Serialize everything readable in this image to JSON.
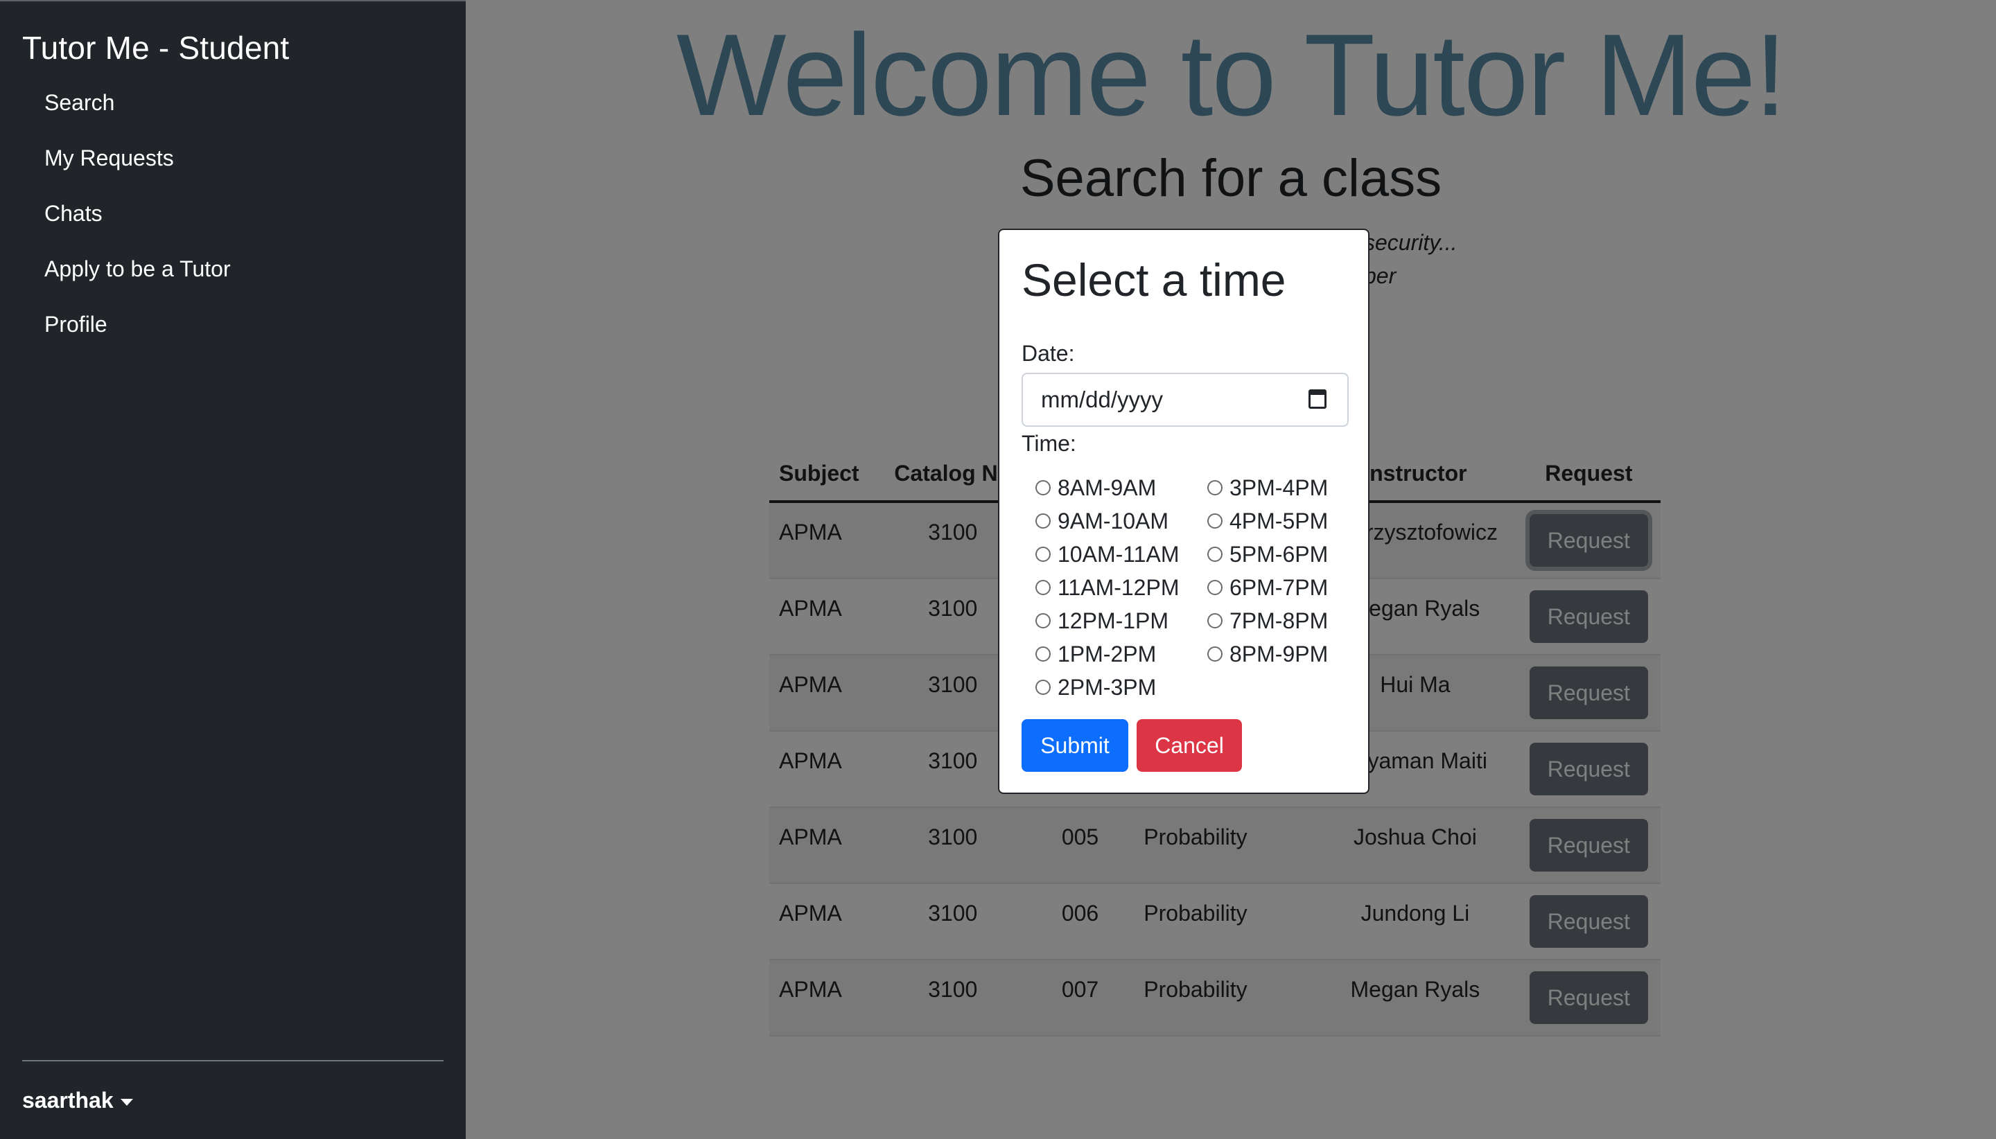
{
  "sidebar": {
    "brand": "Tutor Me - Student",
    "items": [
      {
        "label": "Search"
      },
      {
        "label": "My Requests"
      },
      {
        "label": "Chats"
      },
      {
        "label": "Apply to be a Tutor"
      },
      {
        "label": "Profile"
      }
    ],
    "user": "saarthak"
  },
  "main": {
    "welcome": "Welcome to Tutor Me!",
    "search_title": "Search for a class",
    "subtext_line1": "security...",
    "subtext_line2": "ber"
  },
  "table": {
    "headers": [
      "Subject",
      "Catalog Nu",
      "",
      "",
      "Instructor",
      "Request"
    ],
    "rows": [
      {
        "subject": "APMA",
        "catalog": "3100",
        "section": "",
        "title": "",
        "instructor": "n Krzysztofowicz",
        "button": "Request"
      },
      {
        "subject": "APMA",
        "catalog": "3100",
        "section": "",
        "title": "",
        "instructor": "Megan Ryals",
        "button": "Request"
      },
      {
        "subject": "APMA",
        "catalog": "3100",
        "section": "",
        "title": "",
        "instructor": "Hui Ma",
        "button": "Request"
      },
      {
        "subject": "APMA",
        "catalog": "3100",
        "section": "",
        "title": "",
        "instructor": "epyaman Maiti",
        "button": "Request"
      },
      {
        "subject": "APMA",
        "catalog": "3100",
        "section": "005",
        "title": "Probability",
        "instructor": "Joshua Choi",
        "button": "Request"
      },
      {
        "subject": "APMA",
        "catalog": "3100",
        "section": "006",
        "title": "Probability",
        "instructor": "Jundong Li",
        "button": "Request"
      },
      {
        "subject": "APMA",
        "catalog": "3100",
        "section": "007",
        "title": "Probability",
        "instructor": "Megan Ryals",
        "button": "Request"
      }
    ]
  },
  "modal": {
    "title": "Select a time",
    "date_label": "Date:",
    "date_placeholder": "mm/dd/yyyy",
    "time_label": "Time:",
    "time_slots_left": [
      "8AM-9AM",
      "9AM-10AM",
      "10AM-11AM",
      "11AM-12PM",
      "12PM-1PM",
      "1PM-2PM",
      "2PM-3PM"
    ],
    "time_slots_right": [
      "3PM-4PM",
      "4PM-5PM",
      "5PM-6PM",
      "6PM-7PM",
      "7PM-8PM",
      "8PM-9PM"
    ],
    "submit_label": "Submit",
    "cancel_label": "Cancel"
  },
  "colors": {
    "sidebar_bg": "#212529",
    "welcome_text": "#5b8fa8",
    "submit": "#0d6efd",
    "cancel": "#dc3545",
    "request_button": "#6c757d"
  }
}
